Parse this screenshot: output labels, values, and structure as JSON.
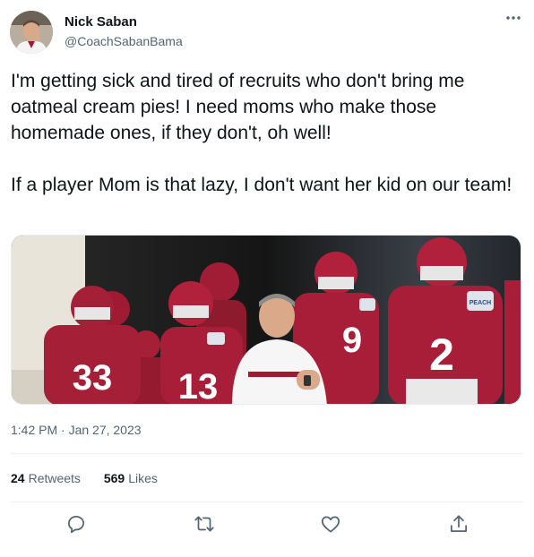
{
  "author": {
    "display_name": "Nick Saban",
    "handle": "@CoachSabanBama"
  },
  "tweet": {
    "paragraphs": [
      "I'm getting sick and tired of recruits who don't bring me oatmeal cream pies! I need moms who make those homemade ones, if they don't, oh well!",
      "If a player Mom is that lazy, I don't want her kid on our team!"
    ],
    "timestamp": "1:42 PM · Jan 27, 2023"
  },
  "media": {
    "jersey_numbers": [
      "33",
      "13",
      "9",
      "2"
    ],
    "patch_text": "PEACH"
  },
  "stats": {
    "retweets_count": "24",
    "retweets_label": "Retweets",
    "likes_count": "569",
    "likes_label": "Likes"
  },
  "icons": {
    "more": "more-dots-icon",
    "reply": "reply-icon",
    "retweet": "retweet-icon",
    "like": "like-icon",
    "share": "share-icon"
  },
  "colors": {
    "text_primary": "#0f1419",
    "text_secondary": "#536471",
    "divider": "#eff3f4",
    "crimson": "#9e1b32"
  }
}
